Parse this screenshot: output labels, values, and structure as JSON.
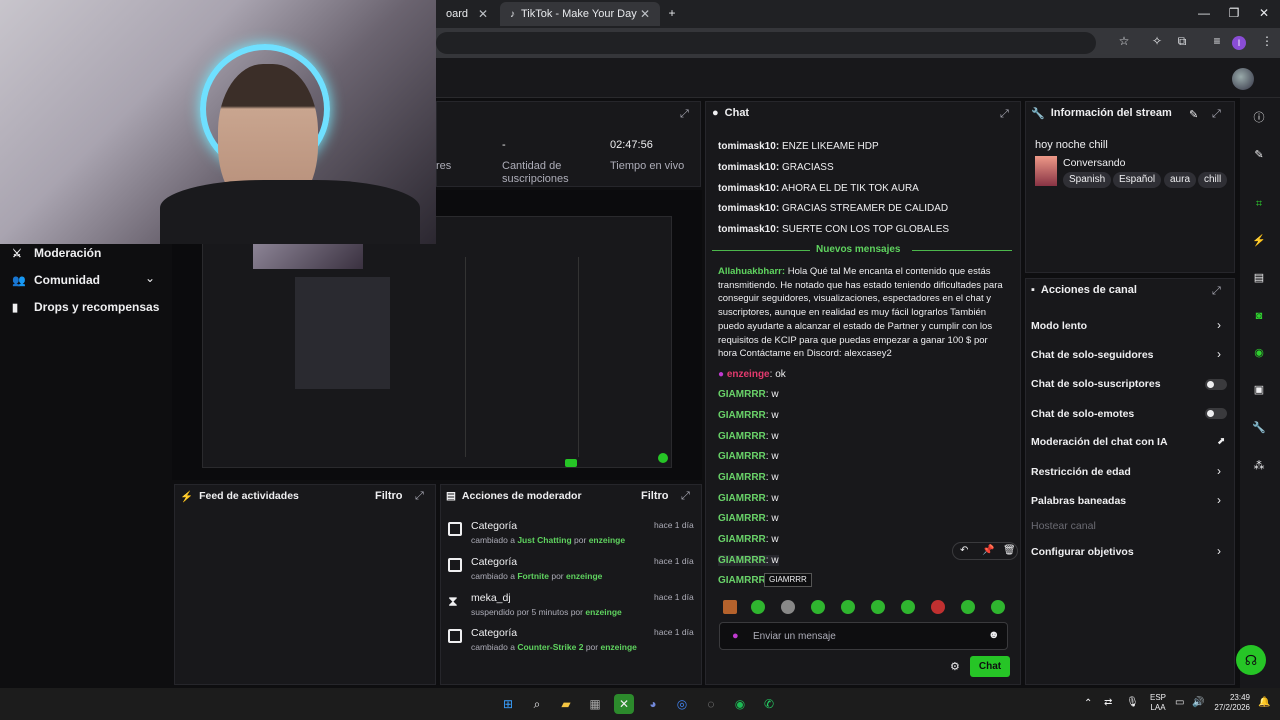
{
  "browser": {
    "tab1_label": "oard",
    "tab2_label": "TikTok - Make Your Day"
  },
  "nav": {
    "items": [
      "Moderación",
      "Comunidad",
      "Drops y recompensas"
    ]
  },
  "stats": {
    "subs_value": "-",
    "subs_label_1": "Cantidad de",
    "subs_label_2": "suscripciones",
    "live_value": "02:47:56",
    "live_label": "Tiempo en vivo",
    "partial_label": "res"
  },
  "chat": {
    "title": "Chat",
    "pre_lines": [
      {
        "user": "tomimask10",
        "msg": "ENZE LIKEAME HDP"
      },
      {
        "user": "tomimask10",
        "msg": "GRACIASS"
      },
      {
        "user": "tomimask10",
        "msg": "AHORA EL DE TIK TOK AURA"
      },
      {
        "user": "tomimask10",
        "msg": "GRACIAS STREAMER DE CALIDAD"
      },
      {
        "user": "tomimask10",
        "msg": "SUERTE CON LOS TOP GLOBALES"
      }
    ],
    "new_messages": "Nuevos mensajes",
    "big_user": "Allahuakbharr",
    "big_msg": "Hola Qué tal Me encanta el contenido que estás transmitiendo. He notado que has estado teniendo dificultades para conseguir seguidores, visualizaciones, espectadores en el chat y suscriptores, aunque en realidad es muy fácil lograrlos También puedo ayudarte a alcanzar el estado de Partner y cumplir con los requisitos de KCIP para que puedas empezar a ganar 100 $ por hora Contáctame en Discord: alexcasey2",
    "enzeinge_user": "enzeinge",
    "enzeinge_msg": "ok",
    "w_user": "GIAMRRR",
    "w_msg": "w",
    "tooltip": "GIAMRRR",
    "input_placeholder": "Enviar un mensaje",
    "send_label": "Chat"
  },
  "stream_info": {
    "title": "Información del stream",
    "stream_title": "hoy noche chill",
    "category": "Conversando",
    "tags": [
      "Spanish",
      "Español",
      "aura",
      "chill"
    ]
  },
  "channel_actions": {
    "title": "Acciones de canal",
    "items": [
      "Modo lento",
      "Chat de solo-seguidores",
      "Chat de solo-suscriptores",
      "Chat de solo-emotes",
      "Moderación del chat con IA",
      "Restricción de edad",
      "Palabras baneadas",
      "Hostear canal",
      "Configurar objetivos"
    ]
  },
  "activity_feed": {
    "title": "Feed de actividades",
    "filter": "Filtro"
  },
  "mod_actions": {
    "title": "Acciones de moderador",
    "filter": "Filtro",
    "entries": [
      {
        "title": "Categoría",
        "pre": "cambiado a",
        "target": "Just Chatting",
        "mid": "por",
        "by": "enzeinge",
        "when": "hace 1 día"
      },
      {
        "title": "Categoría",
        "pre": "cambiado a",
        "target": "Fortnite",
        "mid": "por",
        "by": "enzeinge",
        "when": "hace 1 día"
      },
      {
        "title": "meka_dj",
        "pre": "suspendido por 5 minutos por",
        "target": "",
        "mid": "",
        "by": "enzeinge",
        "when": "hace 1 día"
      },
      {
        "title": "Categoría",
        "pre": "cambiado a",
        "target": "Counter-Strike 2",
        "mid": "por",
        "by": "enzeinge",
        "when": "hace 1 día"
      }
    ]
  },
  "taskbar": {
    "lang_1": "ESP",
    "lang_2": "LAA",
    "time": "23:49",
    "date": "27/2/2026"
  },
  "colors": {
    "accent_green": "#5fd35f",
    "bg": "#0e0e10",
    "panel": "#18181b"
  }
}
